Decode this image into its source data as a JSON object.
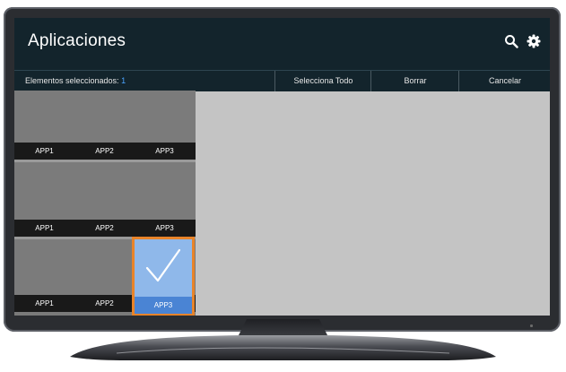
{
  "header": {
    "title": "Aplicaciones",
    "icons": [
      "search-icon",
      "gear-icon"
    ]
  },
  "toolbar": {
    "selected_label": "Elementos seleccionados:",
    "selected_count": "1",
    "select_all": "Selecciona Todo",
    "delete": "Borrar",
    "cancel": "Cancelar"
  },
  "grid": {
    "rows": [
      [
        "APP1",
        "APP2",
        "APP3"
      ],
      [
        "APP1",
        "APP2",
        "APP3"
      ],
      [
        "APP1",
        "APP2",
        "APP3"
      ]
    ],
    "selected": {
      "row": 3,
      "col": 3
    }
  },
  "colors": {
    "header_bg": "#13242c",
    "selected_accent": "#4a84d4",
    "selection_outline": "#e8842a",
    "count_color": "#4aa3ff"
  }
}
